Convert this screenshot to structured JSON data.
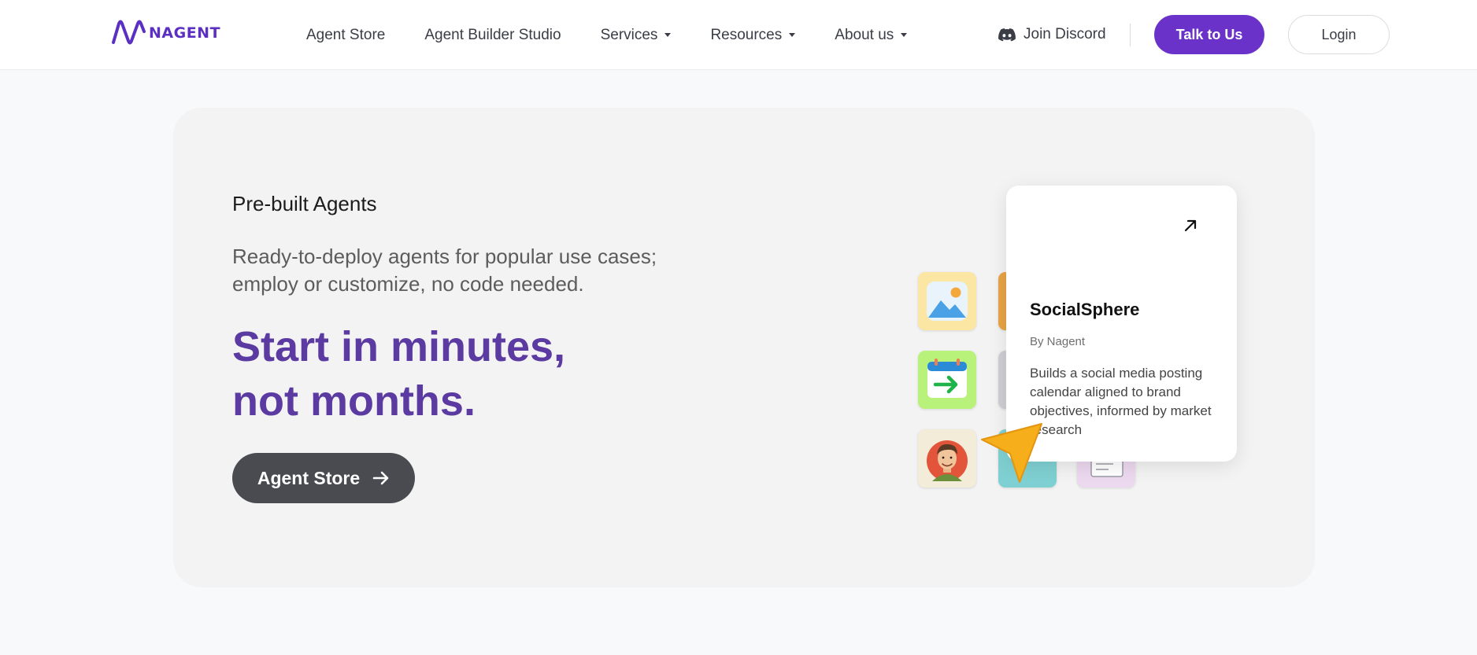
{
  "brand": {
    "name": "NAGENT",
    "color": "#5a2fc2"
  },
  "nav": {
    "links": [
      {
        "label": "Agent Store",
        "dropdown": false
      },
      {
        "label": "Agent Builder Studio",
        "dropdown": false
      },
      {
        "label": "Services",
        "dropdown": true
      },
      {
        "label": "Resources",
        "dropdown": true
      },
      {
        "label": "About us",
        "dropdown": true
      }
    ],
    "discord_label": "Join Discord",
    "talk_label": "Talk to Us",
    "login_label": "Login",
    "accent": "#6b32c9"
  },
  "hero": {
    "eyebrow": "Pre-built Agents",
    "subtitle": "Ready-to-deploy agents for popular use cases; employ or customize, no code needed.",
    "headline_line1": "Start in minutes,",
    "headline_line2": "not months.",
    "headline_color": "#5b3aa1",
    "cta_label": "Agent Store"
  },
  "tiles": [
    {
      "icon": "image-icon",
      "bg": "#fbe6a3"
    },
    {
      "icon": "orange-tile-icon",
      "bg": "#e8a445"
    },
    {
      "icon": "calendar-arrow-icon",
      "bg": "#b9f27a"
    },
    {
      "icon": "gray-tile-icon",
      "bg": "#cfcfd4"
    },
    {
      "icon": "avatar-icon",
      "bg": "#f3ecd9"
    },
    {
      "icon": "teal-tile-icon",
      "bg": "#7fd0d2"
    },
    {
      "icon": "document-icon",
      "bg": "#ecd8ef"
    }
  ],
  "agent_card": {
    "title": "SocialSphere",
    "by": "By Nagent",
    "description": "Builds a social media posting calendar aligned to brand objectives, informed by market research"
  },
  "cursor_color": "#f6ae1a"
}
